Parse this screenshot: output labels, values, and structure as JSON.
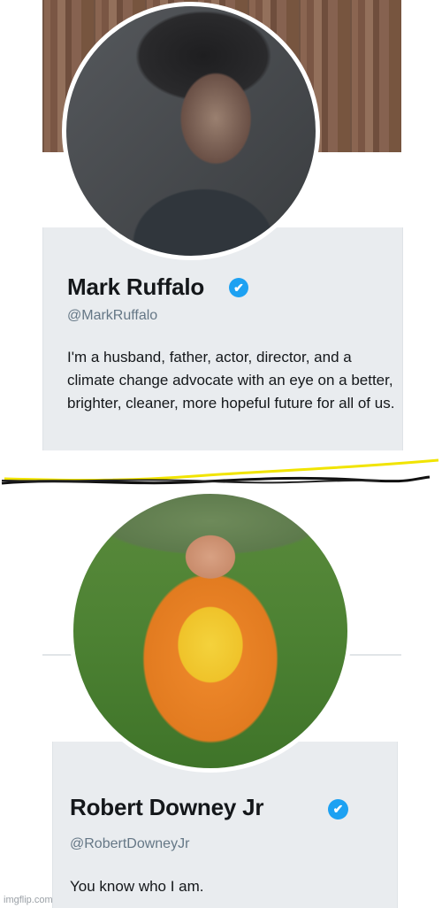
{
  "profile_top": {
    "name": "Mark Ruffalo",
    "handle": "@MarkRuffalo",
    "bio": "I'm a husband, father, actor, director, and a climate change advocate with an eye on a better, brighter, cleaner, more hopeful future for all of us.",
    "verified_glyph": "✔"
  },
  "profile_bottom": {
    "name": "Robert Downey Jr",
    "handle": "@RobertDowneyJr",
    "bio": "You know who I am.",
    "verified_glyph": "✔"
  },
  "watermark": "imgflip.com",
  "colors": {
    "verified": "#1da1f2",
    "card_bg": "#e9ecef",
    "handle": "#657786",
    "divider_yellow": "#f1e400",
    "divider_black": "#111111"
  },
  "icons": [
    "verified-badge-icon"
  ]
}
